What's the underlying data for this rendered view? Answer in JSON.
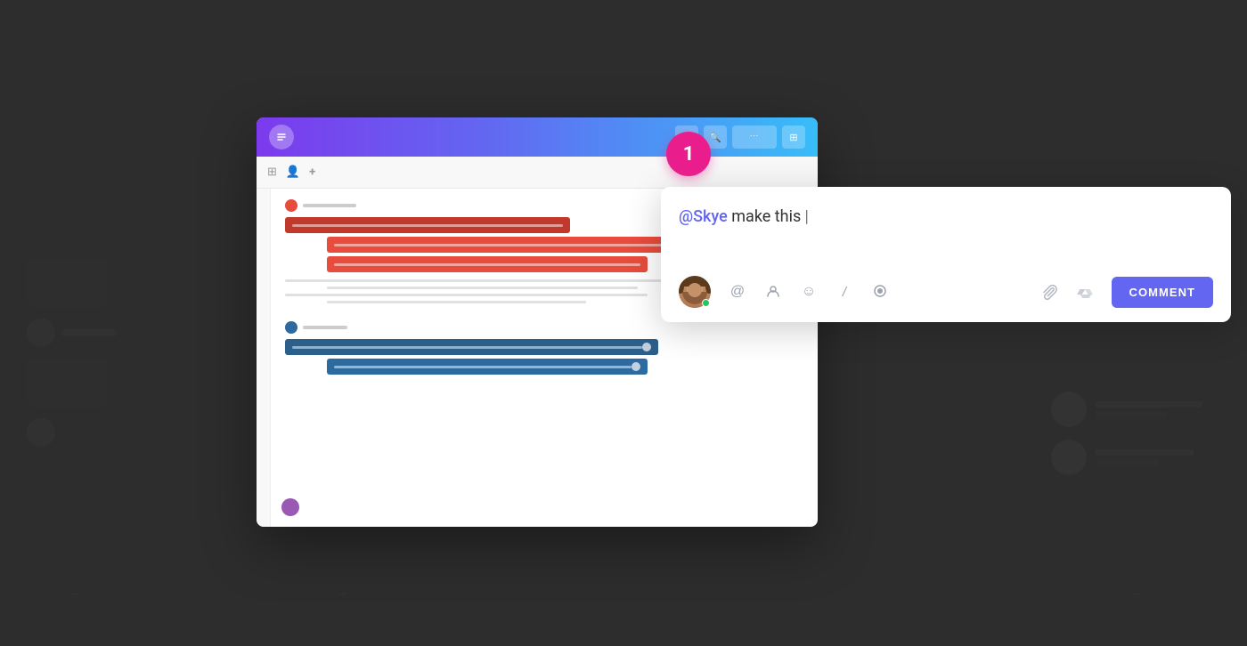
{
  "background": {
    "color": "#2d2d2d"
  },
  "app_window": {
    "header": {
      "logo_text": "↕",
      "icons": [
        "🔔",
        "🔍",
        "···",
        "⊞"
      ]
    },
    "toolbar": {
      "icons": [
        "⊞",
        "👤",
        "+"
      ]
    },
    "sections": [
      {
        "color": "red",
        "bars": [
          {
            "width": "55%",
            "margin_left": "0%"
          },
          {
            "width": "75%",
            "margin_left": "8%"
          },
          {
            "width": "62%",
            "margin_left": "8%"
          }
        ]
      },
      {
        "color": "blue",
        "bars": [
          {
            "width": "72%",
            "margin_left": "0%"
          },
          {
            "width": "62%",
            "margin_left": "8%"
          }
        ]
      }
    ]
  },
  "notification_badge": {
    "number": "1",
    "color": "#e91e8c"
  },
  "comment_popup": {
    "mention": "@Skye",
    "text": " make this ",
    "cursor": "|",
    "toolbar_buttons": [
      {
        "name": "mention",
        "icon": "@"
      },
      {
        "name": "assign",
        "icon": "↕"
      },
      {
        "name": "emoji",
        "icon": "☺"
      },
      {
        "name": "slash",
        "icon": "/"
      },
      {
        "name": "record",
        "icon": "◎"
      }
    ],
    "action_buttons": [
      {
        "name": "attach",
        "icon": "📎"
      },
      {
        "name": "drive",
        "icon": "△"
      }
    ],
    "submit_button": "COMMENT"
  }
}
